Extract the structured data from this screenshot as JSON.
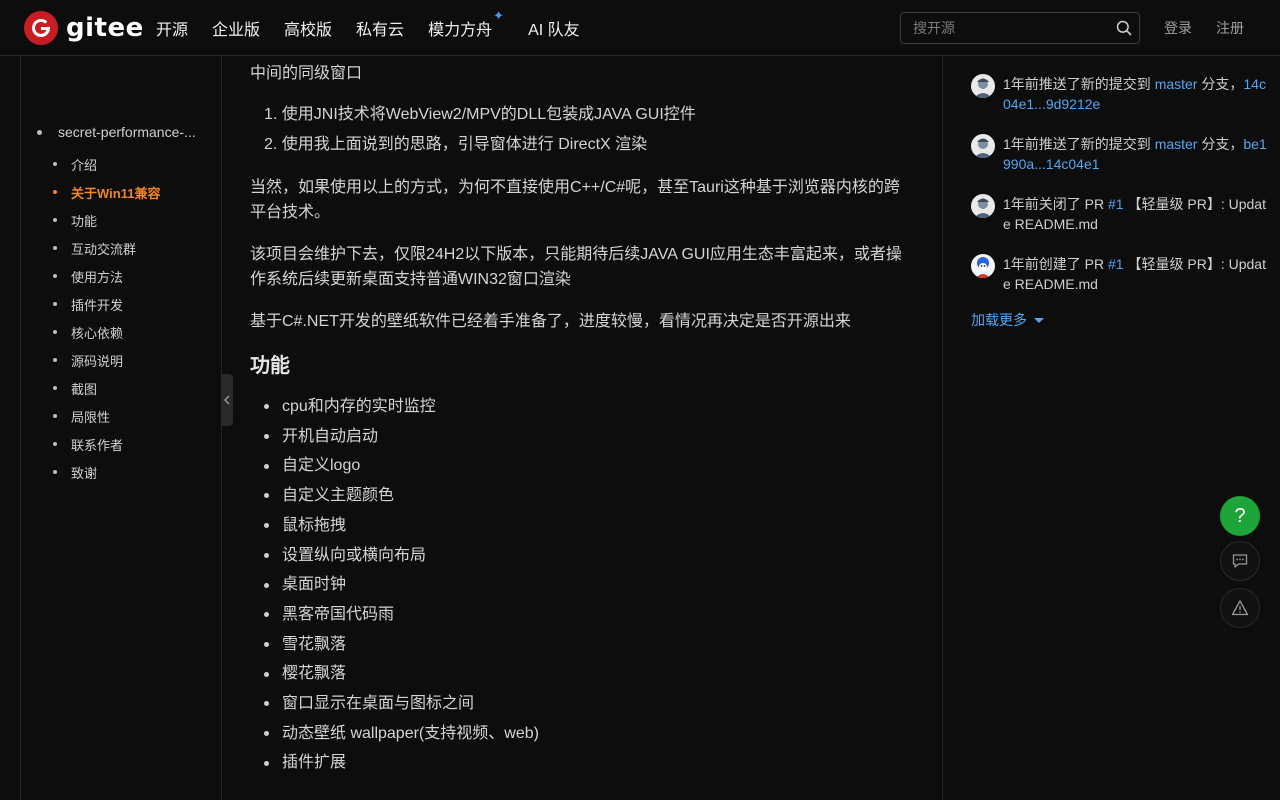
{
  "header": {
    "logo_text": "gitee",
    "nav": [
      {
        "label": "开源"
      },
      {
        "label": "企业版"
      },
      {
        "label": "高校版"
      },
      {
        "label": "私有云"
      },
      {
        "label": "模力方舟",
        "badge": "✦"
      },
      {
        "label": "AI 队友"
      }
    ],
    "search_placeholder": "搜开源",
    "login": "登录",
    "register": "注册"
  },
  "toc": {
    "root": "secret-performance-...",
    "items": [
      {
        "label": "介绍",
        "active": false
      },
      {
        "label": "关于Win11兼容",
        "active": true
      },
      {
        "label": "功能",
        "active": false
      },
      {
        "label": "互动交流群",
        "active": false
      },
      {
        "label": "使用方法",
        "active": false
      },
      {
        "label": "插件开发",
        "active": false
      },
      {
        "label": "核心依赖",
        "active": false
      },
      {
        "label": "源码说明",
        "active": false
      },
      {
        "label": "截图",
        "active": false
      },
      {
        "label": "局限性",
        "active": false
      },
      {
        "label": "联系作者",
        "active": false
      },
      {
        "label": "致谢",
        "active": false
      }
    ]
  },
  "content": {
    "intro_line": "中间的同级窗口",
    "ordered": [
      "1. 使用JNI技术将WebView2/MPV的DLL包装成JAVA GUI控件",
      "2. 使用我上面说到的思路，引导窗体进行 DirectX 渲染"
    ],
    "para1": "当然，如果使用以上的方式，为何不直接使用C++/C#呢，甚至Tauri这种基于浏览器内核的跨平台技术。",
    "para2": "该项目会维护下去，仅限24H2以下版本，只能期待后续JAVA GUI应用生态丰富起来，或者操作系统后续更新桌面支持普通WIN32窗口渲染",
    "para3": "基于C#.NET开发的壁纸软件已经着手准备了，进度较慢，看情况再决定是否开源出来",
    "features_heading": "功能",
    "features": [
      "cpu和内存的实时监控",
      "开机自动启动",
      "自定义logo",
      "自定义主题颜色",
      "鼠标拖拽",
      "设置纵向或横向布局",
      "桌面时钟",
      "黑客帝国代码雨",
      "雪花飘落",
      "樱花飘落",
      "窗口显示在桌面与图标之间",
      "动态壁纸 wallpaper(支持视频、web)",
      "插件扩展"
    ]
  },
  "activity": {
    "items": [
      {
        "prefix": "1年前推送了新的提交到 ",
        "link1": "master",
        "middle": " 分支，",
        "link2": "14c04e1...9d9212e",
        "suffix": ""
      },
      {
        "prefix": "1年前推送了新的提交到 ",
        "link1": "master",
        "middle": " 分支，",
        "link2": "be1990a...14c04e1",
        "suffix": ""
      },
      {
        "prefix": "1年前关闭了 PR ",
        "link1": "#1",
        "middle": " 【轻量级 PR】: Update README.md",
        "link2": "",
        "suffix": ""
      },
      {
        "prefix": "1年前创建了 PR ",
        "link1": "#1",
        "middle": " 【轻量级 PR】: Update README.md",
        "link2": "",
        "suffix": ""
      }
    ],
    "load_more": "加载更多"
  },
  "fab": {
    "help": "?"
  },
  "colors": {
    "brand": "#c71d23",
    "link": "#55a6f2",
    "active_toc": "#f0862a",
    "help_button": "#1ea53a"
  }
}
